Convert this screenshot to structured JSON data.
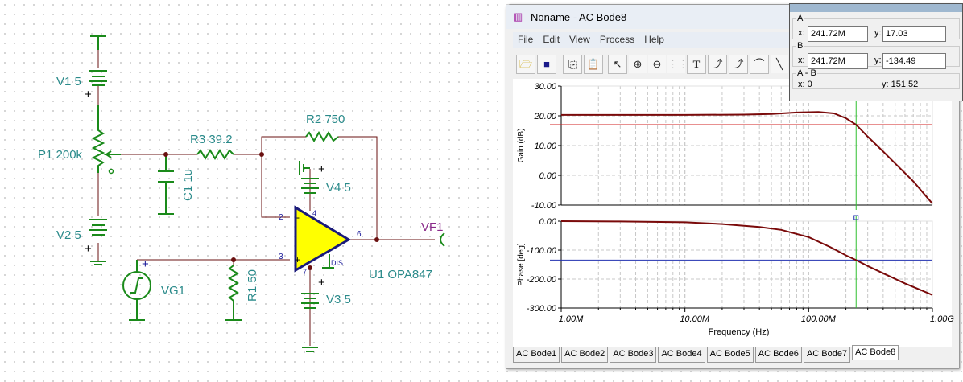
{
  "schematic": {
    "v1": "V1 5",
    "v2": "V2 5",
    "v3": "V3 5",
    "v4": "V4 5",
    "p1": "P1 200k",
    "c1": "C1 1u",
    "r1": "R1 50",
    "r2": "R2 750",
    "r3": "R3 39.2",
    "vg1": "VG1",
    "vf1": "VF1",
    "u1": "U1 OPA847",
    "plus": "+",
    "minus": "-",
    "pin2": "2",
    "pin3": "3",
    "pin4": "4",
    "pin6": "6",
    "pin7": "7",
    "dis": "DIS"
  },
  "window": {
    "title": "Noname - AC Bode8",
    "menu": [
      "File",
      "Edit",
      "View",
      "Process",
      "Help"
    ],
    "toolbar_icons": [
      "open-folder-icon",
      "save-icon",
      "copy-icon",
      "paste-icon",
      "pointer-icon",
      "zoom-in-icon",
      "zoom-100-icon",
      "grid-icon",
      "text-icon",
      "curve-a-icon",
      "curve-b-icon",
      "curve-label-icon",
      "line-icon",
      "circle-icon"
    ],
    "tabs": [
      "AC Bode1",
      "AC Bode2",
      "AC Bode3",
      "AC Bode4",
      "AC Bode5",
      "AC Bode6",
      "AC Bode7",
      "AC Bode8"
    ],
    "active_tab": "AC Bode8"
  },
  "cursors": {
    "a_label": "A",
    "a_x": "241.72M",
    "a_y": "17.03",
    "b_label": "B",
    "b_x": "241.72M",
    "b_y": "-134.49",
    "diff_label": "A - B",
    "diff_x": "x: 0",
    "diff_y": "y: 151.52",
    "x_prefix": "x:",
    "y_prefix": "y:"
  },
  "chart_data": [
    {
      "type": "line",
      "ylabel": "Gain (dB)",
      "xscale": "log",
      "xlim": [
        1000000,
        1000000000
      ],
      "ylim": [
        -10,
        30
      ],
      "yticks": [
        "30.00",
        "20.00",
        "10.00",
        "0.00",
        "-10.00"
      ],
      "grid": true,
      "x": [
        1000000.0,
        3000000.0,
        10000000.0,
        30000000.0,
        50000000.0,
        80000000.0,
        120000000.0,
        160000000.0,
        200000000.0,
        241720000.0,
        300000000.0,
        400000000.0,
        500000000.0,
        700000000.0,
        1000000000.0
      ],
      "y": [
        20.3,
        20.3,
        20.3,
        20.4,
        20.6,
        21.1,
        21.3,
        20.8,
        19.2,
        17.03,
        13,
        8,
        4,
        -2,
        -9.5
      ],
      "series_color": "#7a0a0a",
      "cursor": {
        "x": 241720000.0,
        "y": 17.03,
        "hcolor": "#d02020",
        "vcolor": "#30c030"
      }
    },
    {
      "type": "line",
      "ylabel": "Phase [deg]",
      "xlabel": "Frequency (Hz)",
      "xscale": "log",
      "xlim": [
        1000000,
        1000000000
      ],
      "ylim": [
        -300,
        0
      ],
      "yticks": [
        "0.00",
        "-100.00",
        "-200.00",
        "-300.00"
      ],
      "xticks": [
        "1.00M",
        "10.00M",
        "100.00M",
        "1.00G"
      ],
      "grid": true,
      "x": [
        1000000.0,
        3000000.0,
        10000000.0,
        20000000.0,
        40000000.0,
        60000000.0,
        100000000.0,
        150000000.0,
        200000000.0,
        241720000.0,
        300000000.0,
        400000000.0,
        600000000.0,
        1000000000.0
      ],
      "y": [
        0,
        -1,
        -4,
        -10,
        -20,
        -30,
        -55,
        -90,
        -118,
        -134.49,
        -155,
        -180,
        -215,
        -255
      ],
      "series_color": "#7a0a0a",
      "cursor": {
        "x": 241720000.0,
        "y": -134.49,
        "hcolor": "#2030b0",
        "vcolor": "#30c030"
      }
    }
  ]
}
